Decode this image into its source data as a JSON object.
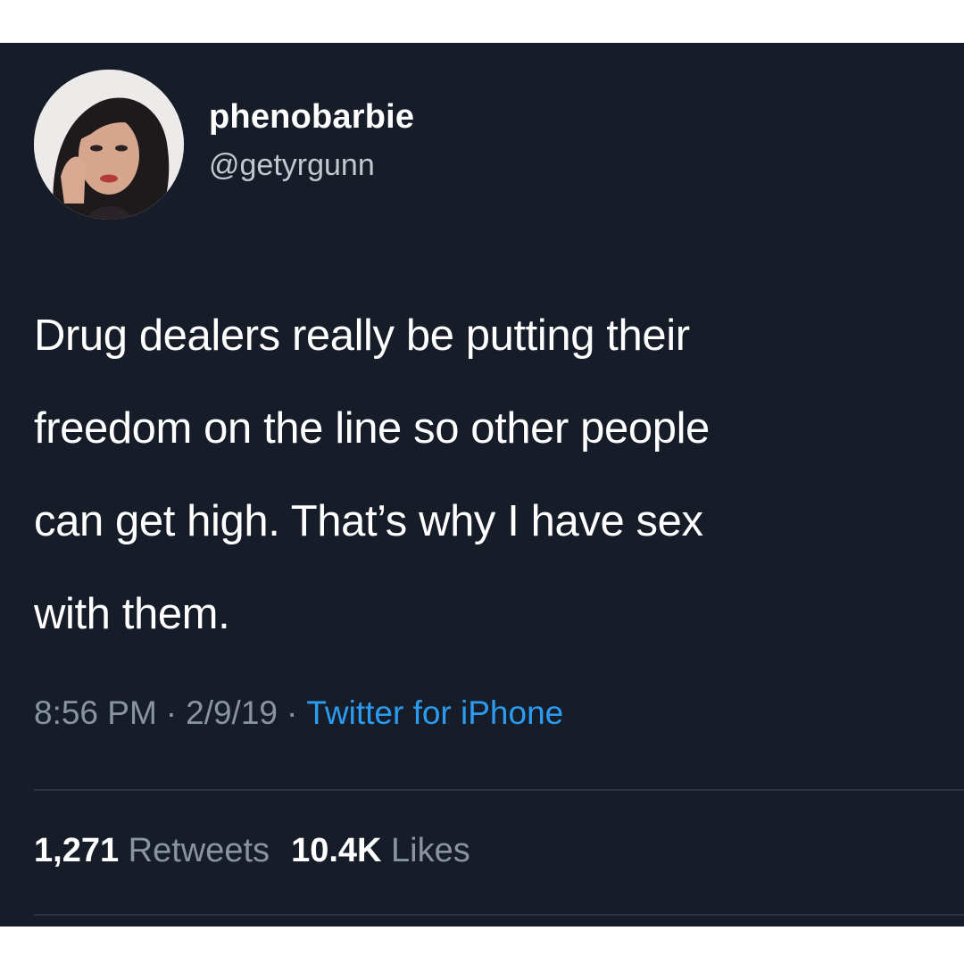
{
  "tweet": {
    "display_name": "phenobarbie",
    "handle": "@getyrgunn",
    "text": "Drug dealers really be putting their\nfreedom on the line so other people\ncan get high. That’s why I have sex\nwith them.",
    "time": "8:56 PM",
    "separator": "·",
    "date": "2/9/19",
    "source": "Twitter for iPhone",
    "retweets_count": "1,271",
    "retweets_label": "Retweets",
    "likes_count": "10.4K",
    "likes_label": "Likes"
  },
  "colors": {
    "background": "#161c28",
    "text": "#ffffff",
    "muted": "#8a949e",
    "link": "#2b9cf0"
  }
}
